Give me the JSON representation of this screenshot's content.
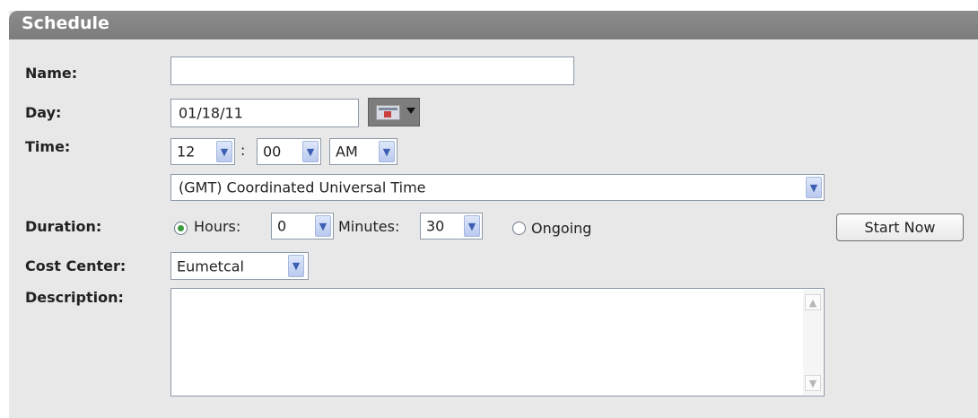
{
  "header": {
    "title": "Schedule"
  },
  "labels": {
    "name": "Name:",
    "day": "Day:",
    "time": "Time:",
    "duration": "Duration:",
    "cost_center": "Cost Center:",
    "description": "Description:"
  },
  "form": {
    "name_value": "",
    "day_value": "01/18/11",
    "hour": "12",
    "time_separator": ":",
    "minute": "00",
    "ampm": "AM",
    "timezone": "(GMT) Coordinated Universal Time",
    "duration": {
      "hours_label": "Hours:",
      "hours_value": "0",
      "minutes_label": "Minutes:",
      "minutes_value": "30",
      "ongoing_label": "Ongoing",
      "selected": "hours"
    },
    "cost_center": "Eumetcal",
    "description_value": ""
  },
  "buttons": {
    "start_now": "Start Now"
  },
  "icons": {
    "calendar": "calendar-icon",
    "dropdown": "chevron-down-icon",
    "scroll_up": "scroll-up-icon",
    "scroll_down": "scroll-down-icon"
  },
  "colors": {
    "header": "#808080",
    "panel": "#e8e8e8",
    "radio_selected": "#3a9b3a",
    "dropdown_arrow": "#3d5fb2"
  }
}
